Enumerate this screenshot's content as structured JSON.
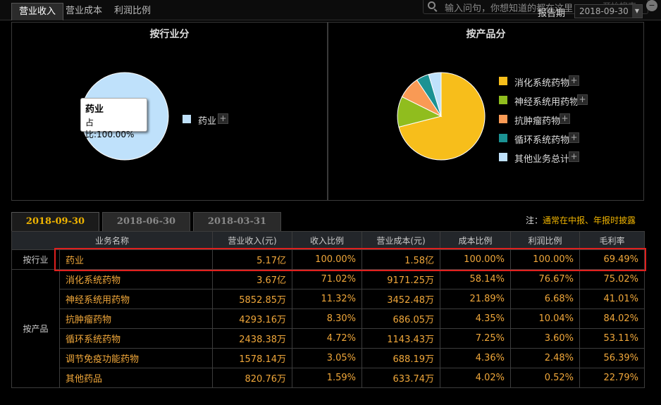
{
  "top_tabs": [
    {
      "label": "营业收入"
    },
    {
      "label": "营业成本"
    },
    {
      "label": "利润比例"
    }
  ],
  "search": {
    "placeholder": "输入问句，你想知道的都在这里",
    "extra": "开始搜索"
  },
  "period": {
    "label": "报告期",
    "selected": "2018-09-30"
  },
  "charts": {
    "industry": {
      "title": "按行业分",
      "legend": [
        {
          "label": "药业",
          "color": "#bfe1fb"
        }
      ],
      "tooltip": {
        "title": "药业",
        "value": "占比:100.00%"
      }
    },
    "product": {
      "title": "按产品分",
      "legend": [
        {
          "label": "消化系统药物",
          "color": "#f7be1b"
        },
        {
          "label": "神经系统用药物",
          "color": "#90bd1e"
        },
        {
          "label": "抗肿瘤药物",
          "color": "#f99a55"
        },
        {
          "label": "循环系统药物",
          "color": "#1b9293"
        },
        {
          "label": "其他业务总计",
          "color": "#bfe1fb"
        }
      ]
    }
  },
  "chart_data": [
    {
      "type": "pie",
      "title": "按行业分",
      "categories": [
        "药业"
      ],
      "values": [
        100.0
      ],
      "colors": [
        "#bfe1fb"
      ]
    },
    {
      "type": "pie",
      "title": "按产品分",
      "categories": [
        "消化系统药物",
        "神经系统用药物",
        "抗肿瘤药物",
        "循环系统药物",
        "其他业务总计"
      ],
      "values": [
        71.02,
        11.32,
        8.3,
        4.72,
        4.64
      ],
      "colors": [
        "#f7be1b",
        "#90bd1e",
        "#f99a55",
        "#1b9293",
        "#bfe1fb"
      ]
    }
  ],
  "date_tabs": [
    {
      "label": "2018-09-30"
    },
    {
      "label": "2018-06-30"
    },
    {
      "label": "2018-03-31"
    }
  ],
  "note": {
    "prefix": "注：",
    "text": "通常在中报、年报时披露"
  },
  "table": {
    "headers": [
      "业务名称",
      "营业收入(元)",
      "收入比例",
      "营业成本(元)",
      "成本比例",
      "利润比例",
      "毛利率"
    ],
    "groups": [
      {
        "category": "按行业",
        "rows": [
          [
            "药业",
            "5.17亿",
            "100.00%",
            "1.58亿",
            "100.00%",
            "100.00%",
            "69.49%"
          ]
        ]
      },
      {
        "category": "按产品",
        "rows": [
          [
            "消化系统药物",
            "3.67亿",
            "71.02%",
            "9171.25万",
            "58.14%",
            "76.67%",
            "75.02%"
          ],
          [
            "神经系统用药物",
            "5852.85万",
            "11.32%",
            "3452.48万",
            "21.89%",
            "6.68%",
            "41.01%"
          ],
          [
            "抗肿瘤药物",
            "4293.16万",
            "8.30%",
            "686.05万",
            "4.35%",
            "10.04%",
            "84.02%"
          ],
          [
            "循环系统药物",
            "2438.38万",
            "4.72%",
            "1143.43万",
            "7.25%",
            "3.60%",
            "53.11%"
          ],
          [
            "调节免疫功能药物",
            "1578.14万",
            "3.05%",
            "688.19万",
            "4.36%",
            "2.48%",
            "56.39%"
          ],
          [
            "其他药品",
            "820.76万",
            "1.59%",
            "633.74万",
            "4.02%",
            "0.52%",
            "22.79%"
          ]
        ]
      }
    ]
  }
}
